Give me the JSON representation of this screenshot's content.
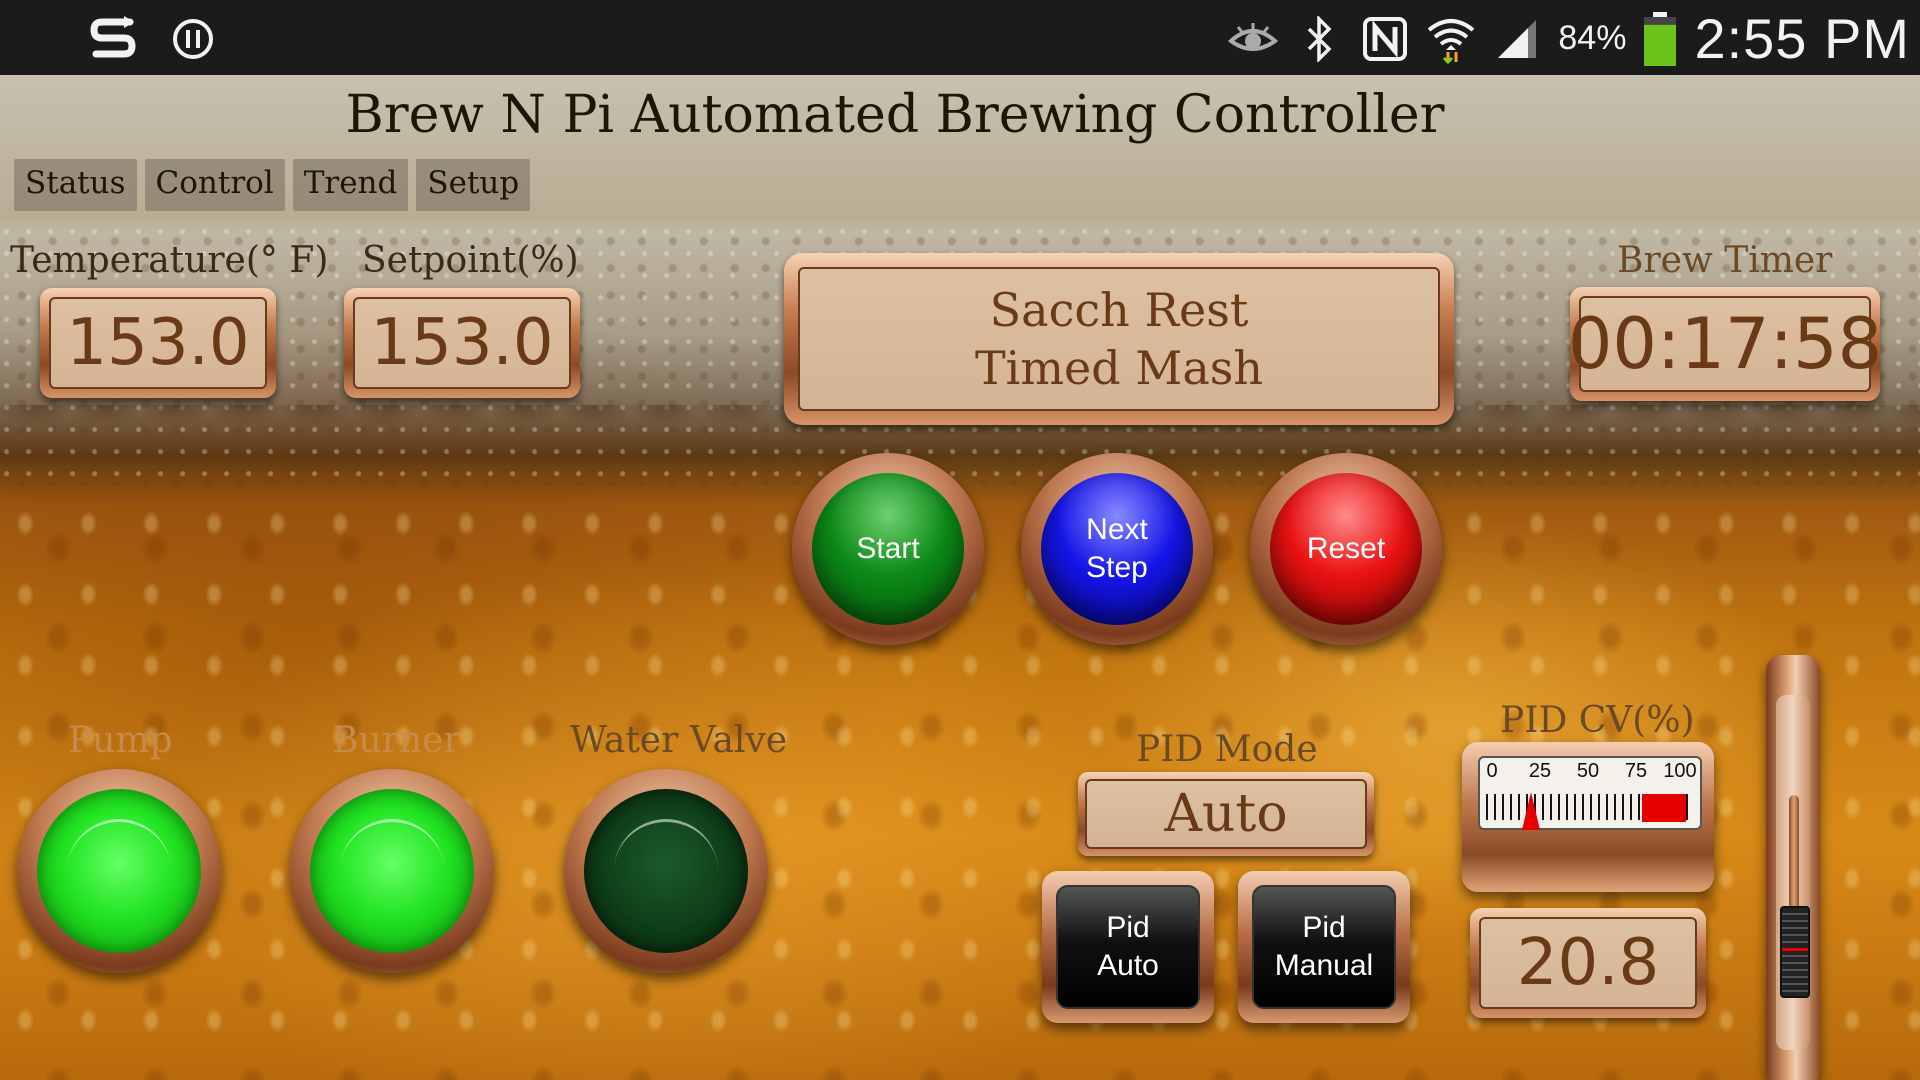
{
  "status_bar": {
    "icons": [
      "s-logo-icon",
      "pause-circle-icon",
      "eye-icon",
      "bluetooth-icon",
      "nfc-icon",
      "wifi-icon",
      "signal-icon",
      "battery-icon"
    ],
    "battery_text": "84%",
    "battery_level": 0.84,
    "clock": "2:55 PM"
  },
  "header": {
    "title": "Brew N Pi Automated Brewing Controller",
    "tabs": [
      "Status",
      "Control",
      "Trend",
      "Setup"
    ]
  },
  "readouts": {
    "temperature_label": "Temperature(° F)",
    "temperature_value": "153.0",
    "setpoint_label": "Setpoint(%)",
    "setpoint_value": "153.0",
    "brew_timer_label": "Brew Timer",
    "brew_timer_value": "00:17:58"
  },
  "step_display": {
    "line1": "Sacch Rest",
    "line2": "Timed Mash"
  },
  "buttons": {
    "start": "Start",
    "next_step_line1": "Next",
    "next_step_line2": "Step",
    "reset": "Reset"
  },
  "indicators": {
    "pump_label": "Pump",
    "pump_state": "on",
    "burner_label": "Burner",
    "burner_state": "on",
    "water_valve_label": "Water Valve",
    "water_valve_state": "off"
  },
  "pid": {
    "mode_label": "PID Mode",
    "mode_value": "Auto",
    "auto_button_line1": "Pid",
    "auto_button_line2": "Auto",
    "manual_button_line1": "Pid",
    "manual_button_line2": "Manual",
    "cv_label": "PID CV(%)",
    "cv_value": "20.8",
    "cv_fraction": 0.208,
    "gauge_scale": [
      "0",
      "25",
      "50",
      "75",
      "100"
    ],
    "slider_fraction": 0.208
  },
  "colors": {
    "lamp_on": "#22e422",
    "lamp_off": "#0e3e18",
    "start": "#0c8a18",
    "next_step": "#1616e8",
    "reset": "#ea1212",
    "copper": "#c47a4c"
  }
}
